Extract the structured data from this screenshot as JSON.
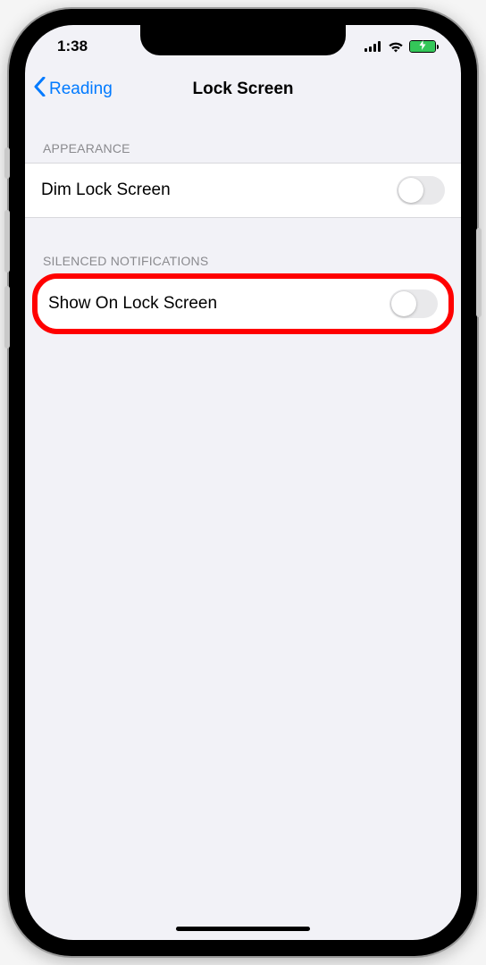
{
  "status": {
    "time": "1:38"
  },
  "nav": {
    "back_label": "Reading",
    "title": "Lock Screen"
  },
  "sections": [
    {
      "header": "APPEARANCE",
      "rows": [
        {
          "label": "Dim Lock Screen",
          "on": false,
          "highlighted": false
        }
      ]
    },
    {
      "header": "SILENCED NOTIFICATIONS",
      "rows": [
        {
          "label": "Show On Lock Screen",
          "on": false,
          "highlighted": true
        }
      ]
    }
  ]
}
